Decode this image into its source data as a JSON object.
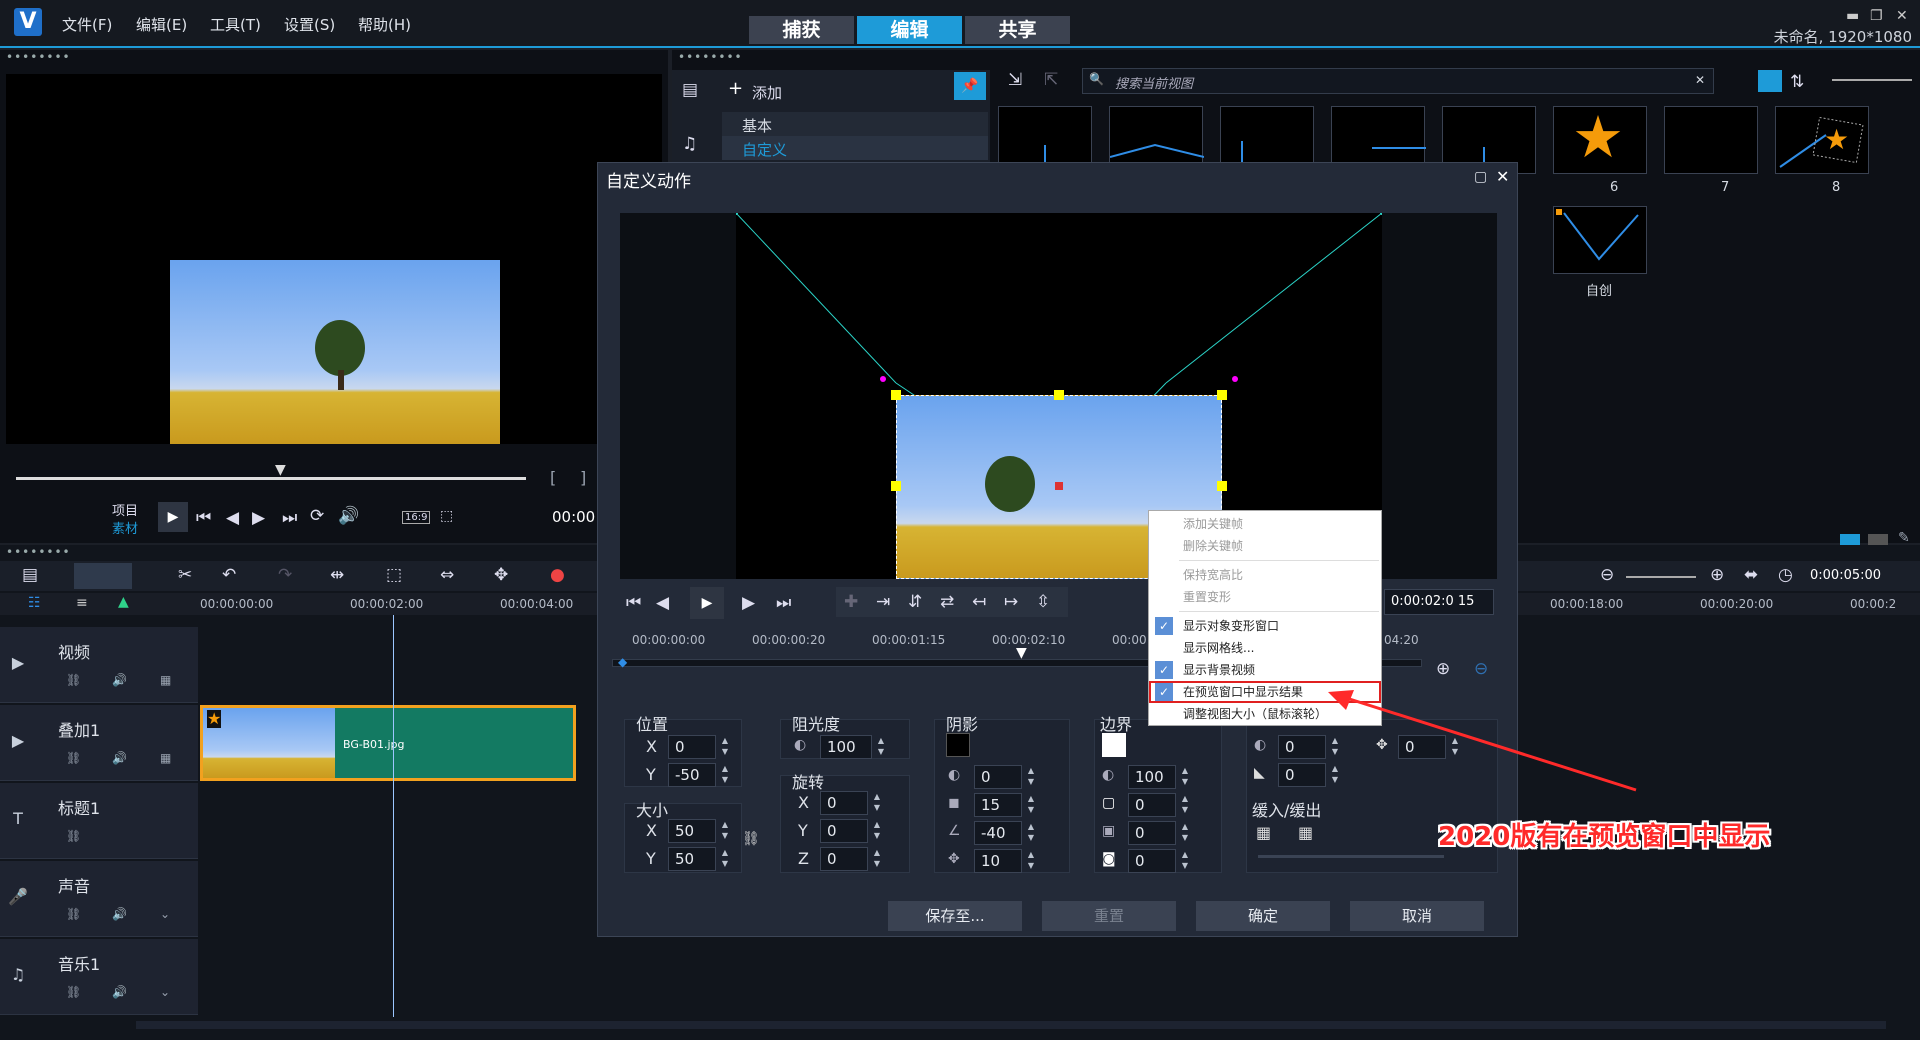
{
  "app": {
    "doc_name": "未命名, 1920*1080",
    "menus": [
      "文件(F)",
      "编辑(E)",
      "工具(T)",
      "设置(S)",
      "帮助(H)"
    ],
    "modes": [
      "捕获",
      "编辑",
      "共享"
    ]
  },
  "player": {
    "mode_project": "项目",
    "mode_clip": "素材",
    "timecode": "00:00",
    "aspect": "16:9"
  },
  "library": {
    "add_label": "添加",
    "categories": [
      "基本",
      "自定义"
    ],
    "search_placeholder": "搜索当前视图",
    "thumbs_row1": [
      "",
      "",
      "",
      "",
      "",
      "6",
      "7",
      "8"
    ],
    "thumbs_row2": [
      "自创"
    ]
  },
  "timeline": {
    "ruler_left": [
      "00:00:00:00",
      "00:00:02:00",
      "00:00:04:00"
    ],
    "ruler_right": [
      "00:00:18:00",
      "00:00:20:00",
      "00:00:2"
    ],
    "duration": "0:00:05:00",
    "tracks": [
      "视频",
      "叠加1",
      "标题1",
      "声音",
      "音乐1"
    ],
    "clip_name": "BG-B01.jpg"
  },
  "dialog": {
    "title": "自定义动作",
    "timecode": "0:00:02:0 15",
    "ruler": [
      "00:00:00:00",
      "00:00:00:20",
      "00:00:01:15",
      "00:00:02:10",
      "00:00:03:05",
      "04:20"
    ],
    "position": {
      "label": "位置",
      "x": "0",
      "y": "-50"
    },
    "size": {
      "label": "大小",
      "x": "50",
      "y": "50"
    },
    "opacity": {
      "label": "阻光度",
      "value": "100"
    },
    "rotation": {
      "label": "旋转",
      "x": "0",
      "y": "0",
      "z": "0"
    },
    "shadow": {
      "label": "阴影",
      "opacity": "0",
      "blur": "15",
      "angle": "-40",
      "distance": "10",
      "color": "#000000"
    },
    "border": {
      "label": "边界",
      "opacity": "100",
      "width": "0",
      "soft": "0",
      "corner": "0",
      "color": "#ffffff"
    },
    "extra": {
      "a": "0",
      "b": "0",
      "c": "0"
    },
    "ease_label": "缓入/缓出",
    "axis": {
      "x": "X",
      "y": "Y",
      "z": "Z"
    },
    "buttons": {
      "save_to": "保存至...",
      "reset": "重置",
      "ok": "确定",
      "cancel": "取消"
    }
  },
  "context_menu": {
    "items": [
      {
        "label": "添加关键帧",
        "checked": false,
        "disabled": true
      },
      {
        "label": "删除关键帧",
        "checked": false,
        "disabled": true
      },
      {
        "label": "保持宽高比",
        "checked": false,
        "disabled": true
      },
      {
        "label": "重置变形",
        "checked": false,
        "disabled": true
      },
      {
        "label": "显示对象变形窗口",
        "checked": true,
        "disabled": false
      },
      {
        "label": "显示网格线...",
        "checked": false,
        "disabled": false
      },
      {
        "label": "显示背景视频",
        "checked": true,
        "disabled": false
      },
      {
        "label": "在预览窗口中显示结果",
        "checked": true,
        "disabled": false
      },
      {
        "label": "调整视图大小（鼠标滚轮）",
        "checked": false,
        "disabled": false
      }
    ]
  },
  "annotation": {
    "text": "2020版有在预览窗口中显示",
    "color": "#ff2a2a"
  }
}
